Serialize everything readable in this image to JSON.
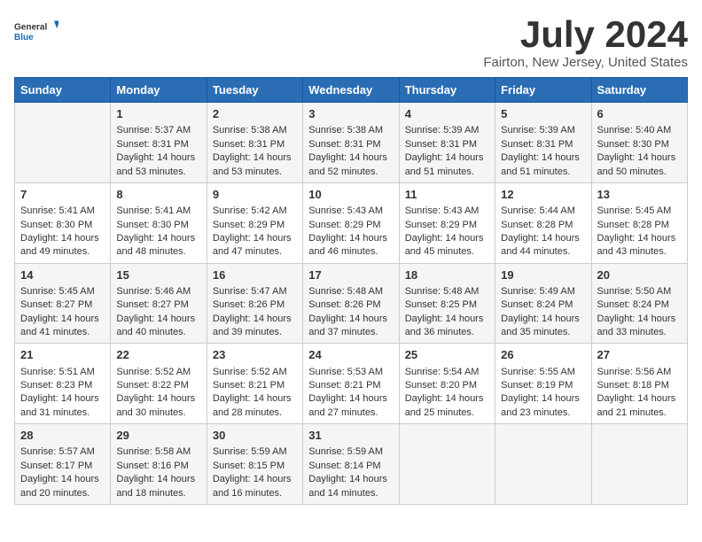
{
  "header": {
    "logo_general": "General",
    "logo_blue": "Blue",
    "month_year": "July 2024",
    "location": "Fairton, New Jersey, United States"
  },
  "weekdays": [
    "Sunday",
    "Monday",
    "Tuesday",
    "Wednesday",
    "Thursday",
    "Friday",
    "Saturday"
  ],
  "weeks": [
    [
      {
        "day": "",
        "content": ""
      },
      {
        "day": "1",
        "content": "Sunrise: 5:37 AM\nSunset: 8:31 PM\nDaylight: 14 hours\nand 53 minutes."
      },
      {
        "day": "2",
        "content": "Sunrise: 5:38 AM\nSunset: 8:31 PM\nDaylight: 14 hours\nand 53 minutes."
      },
      {
        "day": "3",
        "content": "Sunrise: 5:38 AM\nSunset: 8:31 PM\nDaylight: 14 hours\nand 52 minutes."
      },
      {
        "day": "4",
        "content": "Sunrise: 5:39 AM\nSunset: 8:31 PM\nDaylight: 14 hours\nand 51 minutes."
      },
      {
        "day": "5",
        "content": "Sunrise: 5:39 AM\nSunset: 8:31 PM\nDaylight: 14 hours\nand 51 minutes."
      },
      {
        "day": "6",
        "content": "Sunrise: 5:40 AM\nSunset: 8:30 PM\nDaylight: 14 hours\nand 50 minutes."
      }
    ],
    [
      {
        "day": "7",
        "content": "Sunrise: 5:41 AM\nSunset: 8:30 PM\nDaylight: 14 hours\nand 49 minutes."
      },
      {
        "day": "8",
        "content": "Sunrise: 5:41 AM\nSunset: 8:30 PM\nDaylight: 14 hours\nand 48 minutes."
      },
      {
        "day": "9",
        "content": "Sunrise: 5:42 AM\nSunset: 8:29 PM\nDaylight: 14 hours\nand 47 minutes."
      },
      {
        "day": "10",
        "content": "Sunrise: 5:43 AM\nSunset: 8:29 PM\nDaylight: 14 hours\nand 46 minutes."
      },
      {
        "day": "11",
        "content": "Sunrise: 5:43 AM\nSunset: 8:29 PM\nDaylight: 14 hours\nand 45 minutes."
      },
      {
        "day": "12",
        "content": "Sunrise: 5:44 AM\nSunset: 8:28 PM\nDaylight: 14 hours\nand 44 minutes."
      },
      {
        "day": "13",
        "content": "Sunrise: 5:45 AM\nSunset: 8:28 PM\nDaylight: 14 hours\nand 43 minutes."
      }
    ],
    [
      {
        "day": "14",
        "content": "Sunrise: 5:45 AM\nSunset: 8:27 PM\nDaylight: 14 hours\nand 41 minutes."
      },
      {
        "day": "15",
        "content": "Sunrise: 5:46 AM\nSunset: 8:27 PM\nDaylight: 14 hours\nand 40 minutes."
      },
      {
        "day": "16",
        "content": "Sunrise: 5:47 AM\nSunset: 8:26 PM\nDaylight: 14 hours\nand 39 minutes."
      },
      {
        "day": "17",
        "content": "Sunrise: 5:48 AM\nSunset: 8:26 PM\nDaylight: 14 hours\nand 37 minutes."
      },
      {
        "day": "18",
        "content": "Sunrise: 5:48 AM\nSunset: 8:25 PM\nDaylight: 14 hours\nand 36 minutes."
      },
      {
        "day": "19",
        "content": "Sunrise: 5:49 AM\nSunset: 8:24 PM\nDaylight: 14 hours\nand 35 minutes."
      },
      {
        "day": "20",
        "content": "Sunrise: 5:50 AM\nSunset: 8:24 PM\nDaylight: 14 hours\nand 33 minutes."
      }
    ],
    [
      {
        "day": "21",
        "content": "Sunrise: 5:51 AM\nSunset: 8:23 PM\nDaylight: 14 hours\nand 31 minutes."
      },
      {
        "day": "22",
        "content": "Sunrise: 5:52 AM\nSunset: 8:22 PM\nDaylight: 14 hours\nand 30 minutes."
      },
      {
        "day": "23",
        "content": "Sunrise: 5:52 AM\nSunset: 8:21 PM\nDaylight: 14 hours\nand 28 minutes."
      },
      {
        "day": "24",
        "content": "Sunrise: 5:53 AM\nSunset: 8:21 PM\nDaylight: 14 hours\nand 27 minutes."
      },
      {
        "day": "25",
        "content": "Sunrise: 5:54 AM\nSunset: 8:20 PM\nDaylight: 14 hours\nand 25 minutes."
      },
      {
        "day": "26",
        "content": "Sunrise: 5:55 AM\nSunset: 8:19 PM\nDaylight: 14 hours\nand 23 minutes."
      },
      {
        "day": "27",
        "content": "Sunrise: 5:56 AM\nSunset: 8:18 PM\nDaylight: 14 hours\nand 21 minutes."
      }
    ],
    [
      {
        "day": "28",
        "content": "Sunrise: 5:57 AM\nSunset: 8:17 PM\nDaylight: 14 hours\nand 20 minutes."
      },
      {
        "day": "29",
        "content": "Sunrise: 5:58 AM\nSunset: 8:16 PM\nDaylight: 14 hours\nand 18 minutes."
      },
      {
        "day": "30",
        "content": "Sunrise: 5:59 AM\nSunset: 8:15 PM\nDaylight: 14 hours\nand 16 minutes."
      },
      {
        "day": "31",
        "content": "Sunrise: 5:59 AM\nSunset: 8:14 PM\nDaylight: 14 hours\nand 14 minutes."
      },
      {
        "day": "",
        "content": ""
      },
      {
        "day": "",
        "content": ""
      },
      {
        "day": "",
        "content": ""
      }
    ]
  ]
}
